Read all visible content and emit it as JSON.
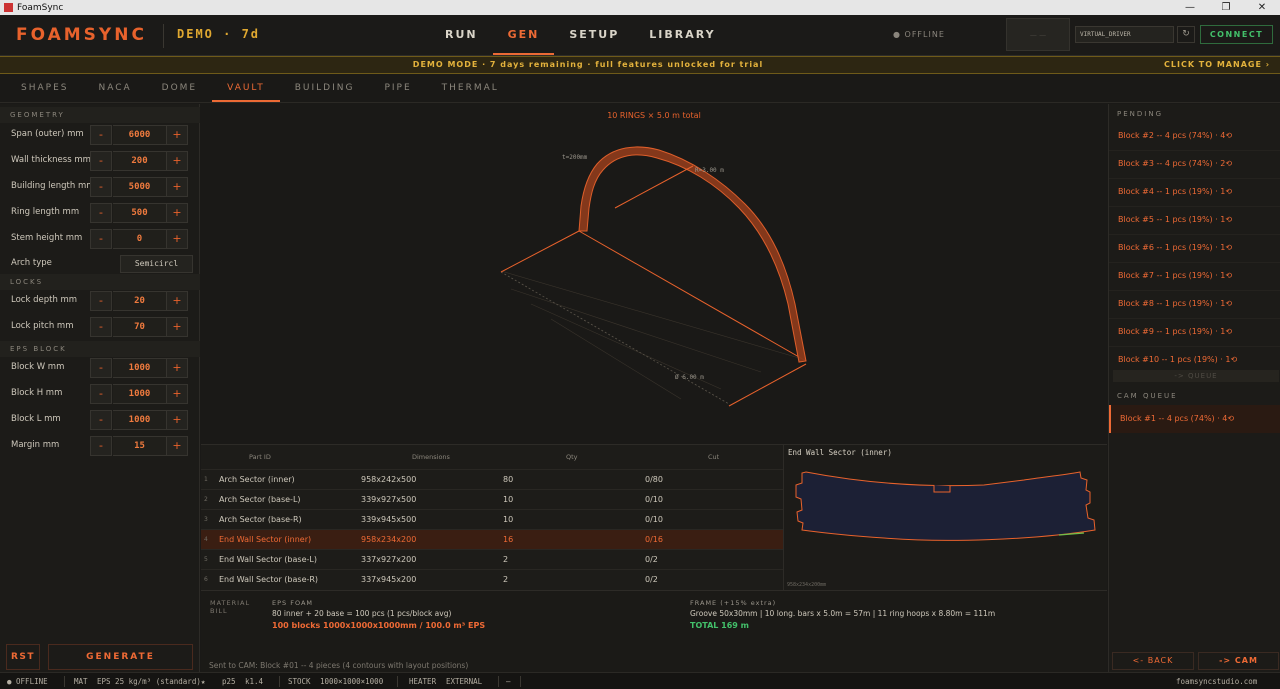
{
  "window": {
    "title": "FoamSync",
    "minimize": "—",
    "maximize": "❐",
    "close": "✕"
  },
  "header": {
    "brand": "FOAMSYNC",
    "demo": "DEMO · 7d",
    "nav": [
      "RUN",
      "GEN",
      "SETUP",
      "LIBRARY"
    ],
    "active_nav": "GEN",
    "offline": "● OFFLINE",
    "small_box": "— —",
    "driver": "VIRTUAL_DRIVER",
    "refresh": "↻",
    "connect": "CONNECT"
  },
  "banner": {
    "message": "DEMO MODE · 7 days remaining · full features unlocked for trial",
    "manage": "CLICK TO MANAGE ›"
  },
  "subtabs": [
    "SHAPES",
    "NACA",
    "DOME",
    "VAULT",
    "BUILDING",
    "PIPE",
    "THERMAL"
  ],
  "active_subtab": "VAULT",
  "left": {
    "geometry_header": "GEOMETRY",
    "geometry": [
      {
        "label": "Span (outer) mm",
        "value": "6000"
      },
      {
        "label": "Wall thickness mm",
        "value": "200"
      },
      {
        "label": "Building length mm",
        "value": "5000"
      },
      {
        "label": "Ring length mm",
        "value": "500"
      },
      {
        "label": "Stem height mm",
        "value": "0"
      }
    ],
    "arch_type_label": "Arch type",
    "arch_type_value": "Semicircl",
    "locks_header": "LOCKS",
    "locks": [
      {
        "label": "Lock depth mm",
        "value": "20"
      },
      {
        "label": "Lock pitch mm",
        "value": "70"
      }
    ],
    "eps_header": "EPS BLOCK",
    "eps": [
      {
        "label": "Block W mm",
        "value": "1000"
      },
      {
        "label": "Block H mm",
        "value": "1000"
      },
      {
        "label": "Block L mm",
        "value": "1000"
      },
      {
        "label": "Margin mm",
        "value": "15"
      }
    ],
    "minus": "-",
    "plus": "+",
    "rst": "RST",
    "generate": "GENERATE"
  },
  "viewport": {
    "title": "10 RINGS  ×  5.0 m total",
    "thickness_label": "t=200mm",
    "radius_label": "R=3.00 m",
    "diameter_label": "Ø 6.00 m"
  },
  "table": {
    "headers": [
      "Part ID",
      "Dimensions",
      "Qty",
      "Cut"
    ],
    "rows": [
      {
        "num": "1",
        "part": "Arch Sector (inner)",
        "dim": "958x242x500",
        "qty": "80",
        "cut": "0/80"
      },
      {
        "num": "2",
        "part": "Arch Sector (base-L)",
        "dim": "339x927x500",
        "qty": "10",
        "cut": "0/10"
      },
      {
        "num": "3",
        "part": "Arch Sector (base-R)",
        "dim": "339x945x500",
        "qty": "10",
        "cut": "0/10"
      },
      {
        "num": "4",
        "part": "End Wall Sector (inner)",
        "dim": "958x234x200",
        "qty": "16",
        "cut": "0/16"
      },
      {
        "num": "5",
        "part": "End Wall Sector (base-L)",
        "dim": "337x927x200",
        "qty": "2",
        "cut": "0/2"
      },
      {
        "num": "6",
        "part": "End Wall Sector (base-R)",
        "dim": "337x945x200",
        "qty": "2",
        "cut": "0/2"
      }
    ],
    "selected_row": 4
  },
  "preview": {
    "title": "End Wall Sector (inner)",
    "dims": "958x234x200mm"
  },
  "bom": {
    "label": "MATERIAL BILL",
    "eps_header": "EPS FOAM",
    "eps_line1": "80 inner  +  20 base  =  100 pcs  (1 pcs/block avg)",
    "eps_line2": "100 blocks  1000x1000x1000mm  /  100.0 m³ EPS",
    "frame_header": "FRAME  (+15% extra)",
    "frame_line1": "Groove 50x30mm  |  10 long. bars x 5.0m = 57m  |  11 ring hoops x 8.80m = 111m",
    "frame_line2": "TOTAL  169 m",
    "sent": "Sent to CAM: Block #01 -- 4 pieces  (4 contours with layout positions)"
  },
  "right": {
    "pending_header": "PENDING",
    "pending": [
      "Block #2  --  4 pcs  (74%)  · 4⟲",
      "Block #3  --  4 pcs  (74%)  · 2⟲",
      "Block #4  --  1 pcs  (19%)  · 1⟲",
      "Block #5  --  1 pcs  (19%)  · 1⟲",
      "Block #6  --  1 pcs  (19%)  · 1⟲",
      "Block #7  --  1 pcs  (19%)  · 1⟲",
      "Block #8  --  1 pcs  (19%)  · 1⟲",
      "Block #9  --  1 pcs  (19%)  · 1⟲",
      "Block #10  --  1 pcs  (19%)  · 1⟲"
    ],
    "queue_button": "-> QUEUE",
    "cam_header": "CAM QUEUE",
    "cam_item": "Block #1  --  4 pcs  (74%)  · 4⟲",
    "back": "<- BACK",
    "cam": "-> CAM"
  },
  "status": {
    "offline": "● OFFLINE",
    "mat": "MAT",
    "material": "EPS 25 kg/m³ (standard)★",
    "p": "p25",
    "k": "k1.4",
    "stock_label": "STOCK",
    "stock": "1000×1000×1000",
    "heater_label": "HEATER",
    "heater": "EXTERNAL",
    "dash": "—",
    "site": "foamsyncstudio.com"
  },
  "colors": {
    "accent": "#ec6a35",
    "warning": "#e3b23c",
    "ok": "#43c06a",
    "background": "#1a1917"
  }
}
